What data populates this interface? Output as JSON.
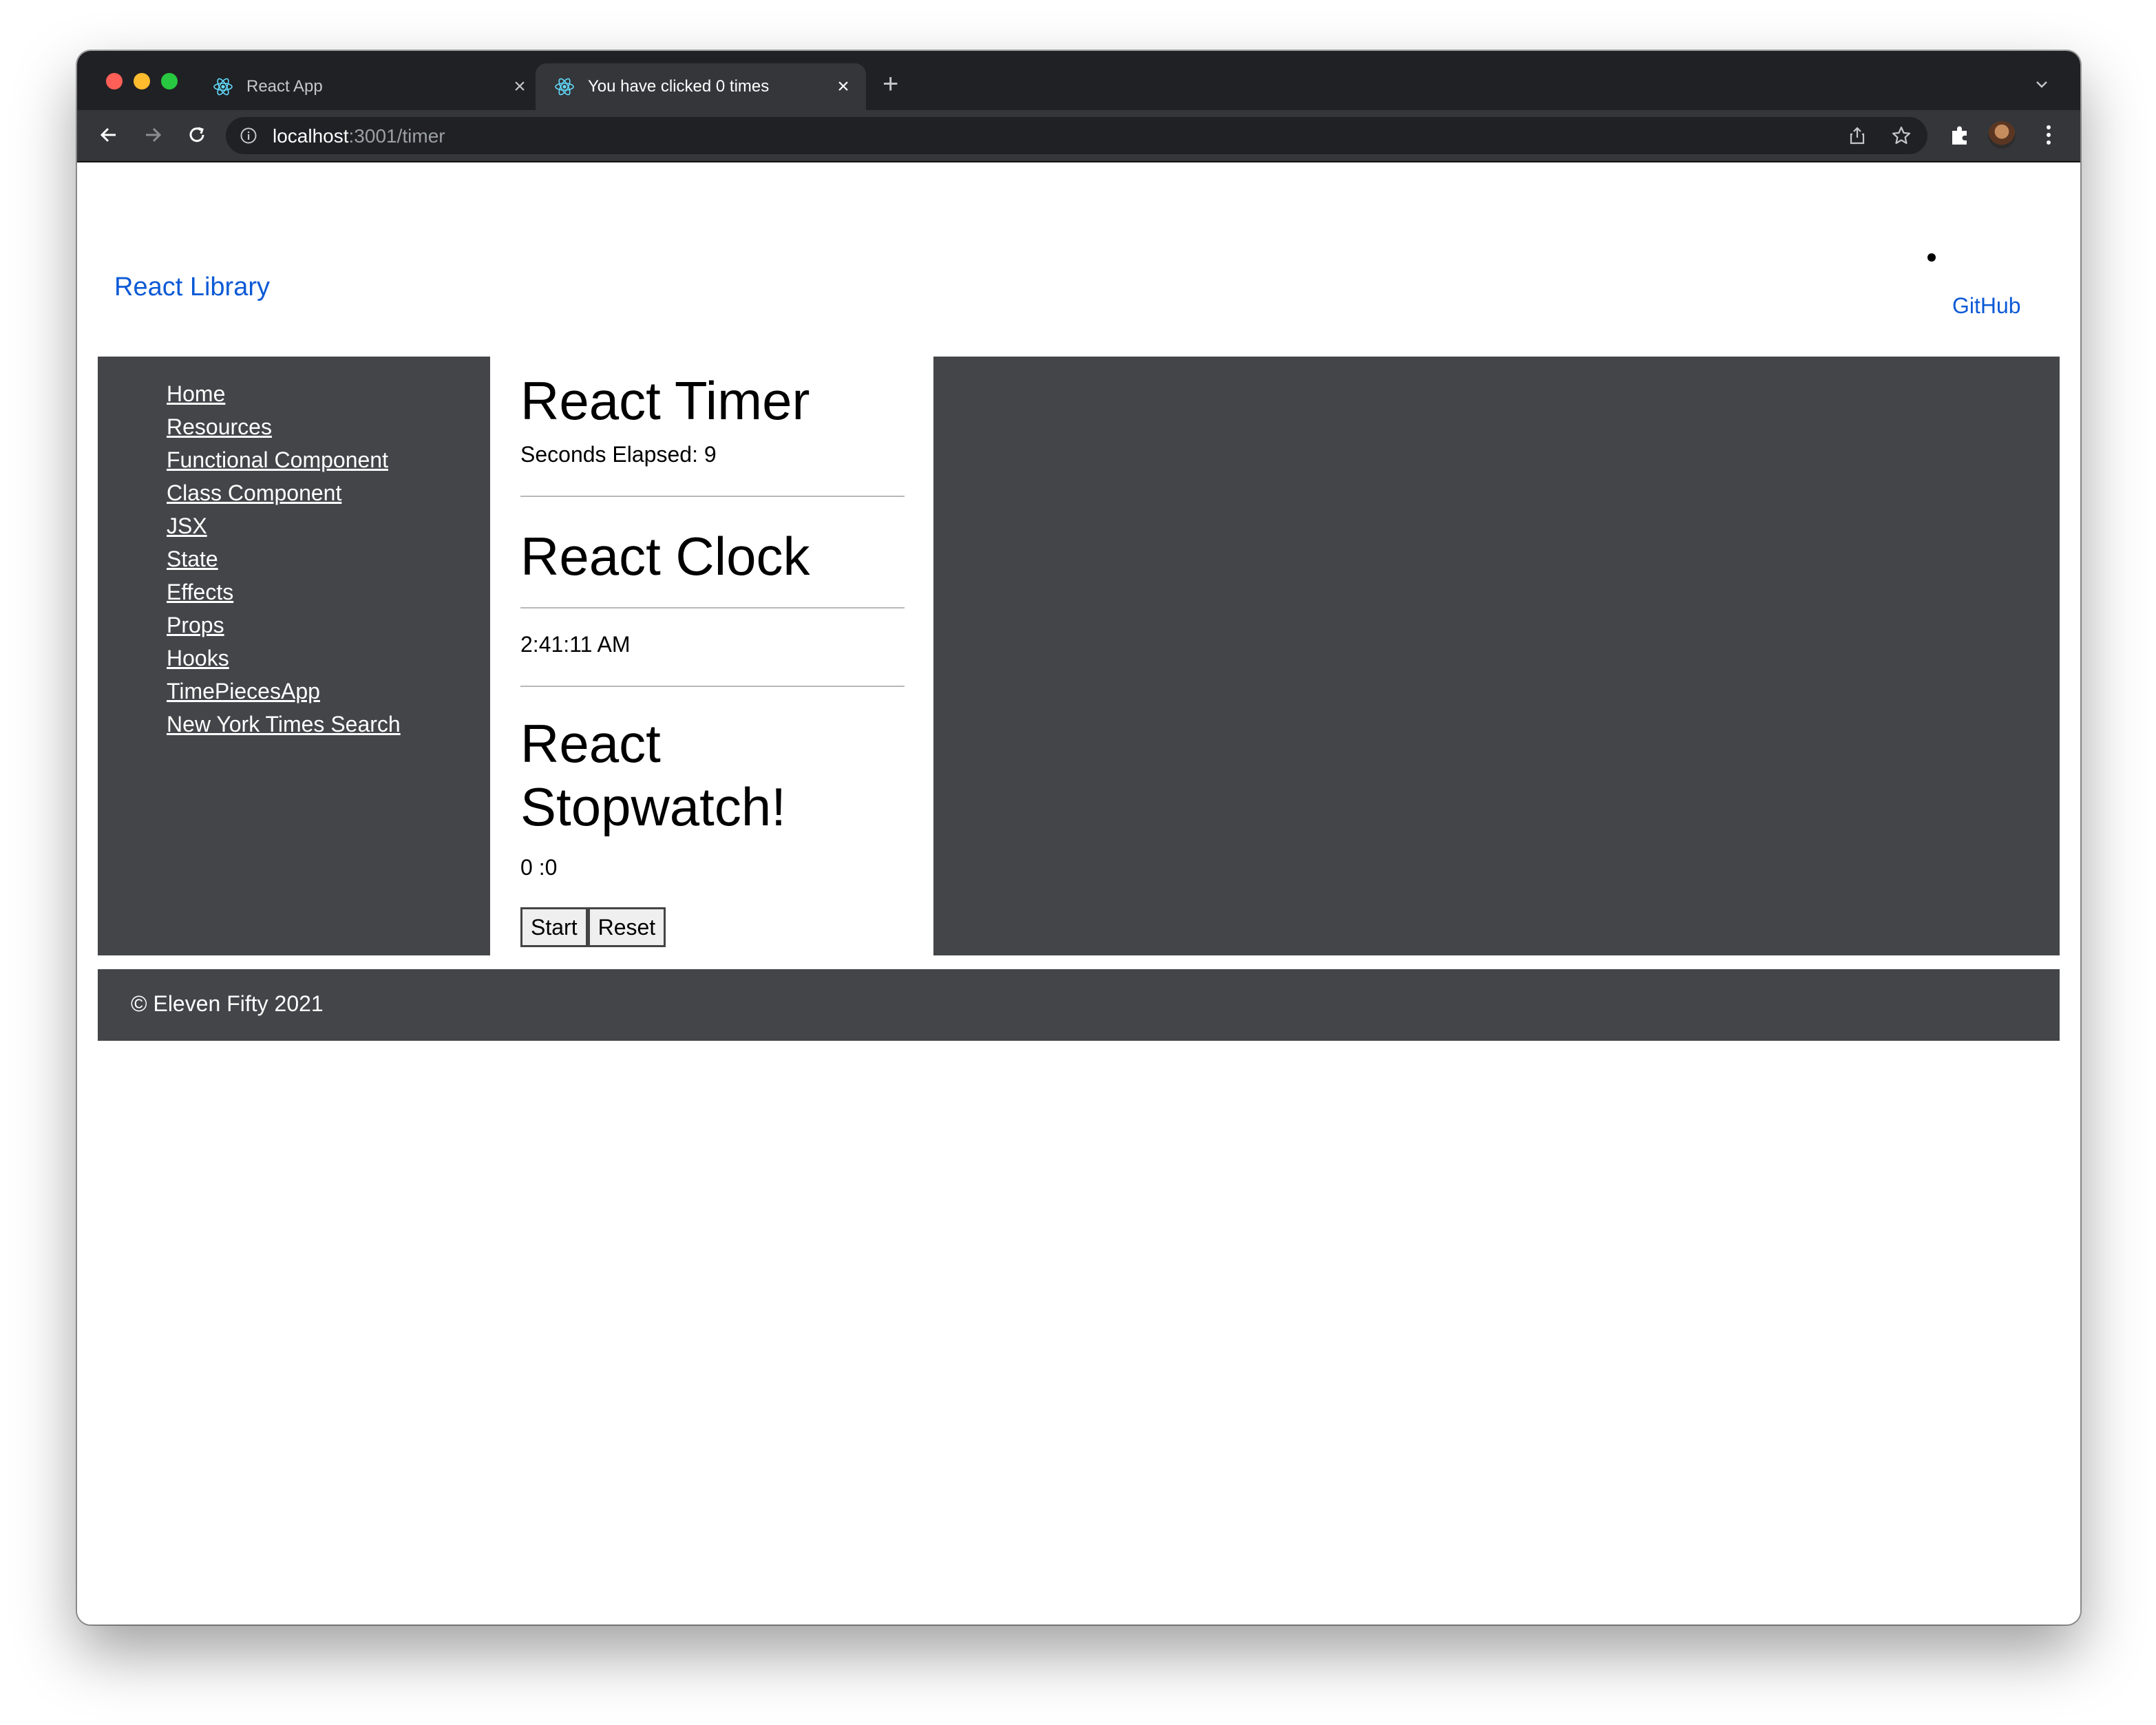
{
  "browser": {
    "tabs": [
      {
        "title": "React App",
        "active": false
      },
      {
        "title": "You have clicked 0 times",
        "active": true
      }
    ],
    "url_host": "localhost",
    "url_path": ":3001/timer",
    "colors": {
      "chrome_bg": "#202124",
      "toolbar_bg": "#35363a"
    }
  },
  "header": {
    "brand": "React Library",
    "nav_link": "GitHub"
  },
  "sidebar": {
    "items": [
      {
        "label": "Home"
      },
      {
        "label": "Resources"
      },
      {
        "label": "Functional Component"
      },
      {
        "label": "Class Component"
      },
      {
        "label": "JSX"
      },
      {
        "label": "State"
      },
      {
        "label": "Effects"
      },
      {
        "label": "Props"
      },
      {
        "label": "Hooks"
      },
      {
        "label": "TimePiecesApp"
      },
      {
        "label": "New York Times Search"
      }
    ]
  },
  "main": {
    "timer_title": "React Timer",
    "timer_text": "Seconds Elapsed: 9",
    "clock_title": "React Clock",
    "clock_time": "2:41:11 AM",
    "stopwatch_title": "React Stopwatch!",
    "stopwatch_time": "0 :0",
    "start_label": "Start",
    "reset_label": "Reset"
  },
  "footer": {
    "text": "© Eleven Fifty 2021"
  },
  "theme": {
    "panel_color": "#444549",
    "link_color": "#0d5ad6"
  }
}
